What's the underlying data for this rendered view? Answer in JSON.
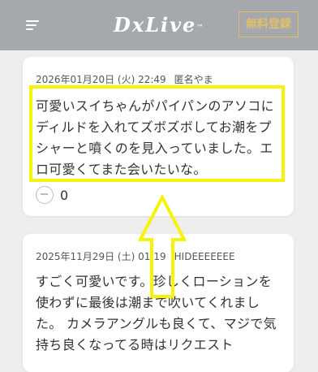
{
  "header": {
    "logo": "DxLive",
    "logo_tm": "™",
    "signup_label": "無料登録"
  },
  "reviews": [
    {
      "date": "2026年01月20日 (火) 22:49",
      "author": "匿名やま",
      "text": "可愛いスイちゃんがパイパンのアソコにディルドを入れてズボズボしてお潮をプシャーと噴くのを見入っていました。エロ可愛くてまた会いたいな。",
      "likes": "0"
    },
    {
      "date": "2025年11月29日 (土) 01:19",
      "author": "HIDEEEEEEE",
      "text": "すごく可愛いです。珍しくローションを使わずに最後は潮まで吹いてくれました。 カメラアングルも良くて、マジで気持ち良くなってる時はリクエスト"
    }
  ],
  "colors": {
    "header_bg": "#a5a9ae",
    "accent": "#e1bf6a",
    "highlight": "#f5f20b"
  }
}
